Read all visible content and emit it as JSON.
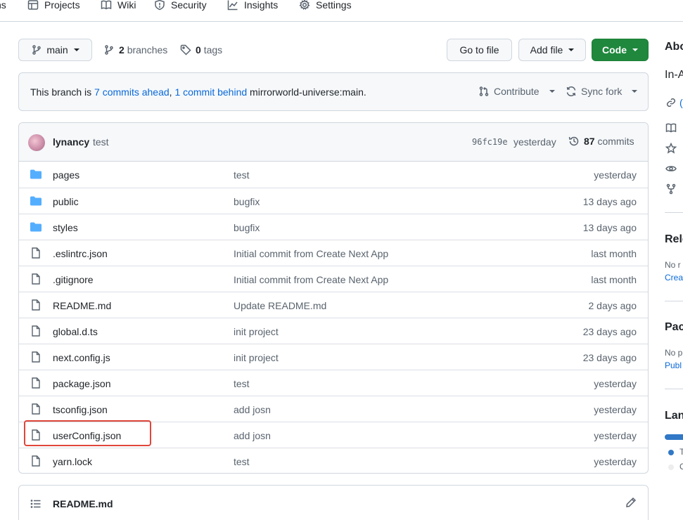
{
  "nav": {
    "items": [
      {
        "label": "ns",
        "icon": "play-icon"
      },
      {
        "label": "Projects",
        "icon": "table-icon"
      },
      {
        "label": "Wiki",
        "icon": "book-icon"
      },
      {
        "label": "Security",
        "icon": "shield-icon"
      },
      {
        "label": "Insights",
        "icon": "graph-icon"
      },
      {
        "label": "Settings",
        "icon": "gear-icon"
      }
    ]
  },
  "toolbar": {
    "branch": "main",
    "branches_count": "2",
    "branches_label": "branches",
    "tags_count": "0",
    "tags_label": "tags",
    "go_to_file": "Go to file",
    "add_file": "Add file",
    "code": "Code"
  },
  "branch_status": {
    "prefix": "This branch is",
    "ahead": "7 commits ahead",
    "separator": ",",
    "behind": "1 commit behind",
    "upstream": "mirrorworld-universe:main.",
    "contribute": "Contribute",
    "sync_fork": "Sync fork"
  },
  "latest_commit": {
    "author": "lynancy",
    "message": "test",
    "hash": "96fc19e",
    "date": "yesterday",
    "count": "87",
    "count_label": "commits"
  },
  "files": [
    {
      "name": "pages",
      "type": "dir",
      "message": "test",
      "date": "yesterday"
    },
    {
      "name": "public",
      "type": "dir",
      "message": "bugfix",
      "date": "13 days ago"
    },
    {
      "name": "styles",
      "type": "dir",
      "message": "bugfix",
      "date": "13 days ago"
    },
    {
      "name": ".eslintrc.json",
      "type": "file",
      "message": "Initial commit from Create Next App",
      "date": "last month"
    },
    {
      "name": ".gitignore",
      "type": "file",
      "message": "Initial commit from Create Next App",
      "date": "last month"
    },
    {
      "name": "README.md",
      "type": "file",
      "message": "Update README.md",
      "date": "2 days ago"
    },
    {
      "name": "global.d.ts",
      "type": "file",
      "message": "init project",
      "date": "23 days ago"
    },
    {
      "name": "next.config.js",
      "type": "file",
      "message": "init project",
      "date": "23 days ago"
    },
    {
      "name": "package.json",
      "type": "file",
      "message": "test",
      "date": "yesterday"
    },
    {
      "name": "tsconfig.json",
      "type": "file",
      "message": "add josn",
      "date": "yesterday"
    },
    {
      "name": "userConfig.json",
      "type": "file",
      "message": "add josn",
      "date": "yesterday"
    },
    {
      "name": "yarn.lock",
      "type": "file",
      "message": "test",
      "date": "yesterday"
    }
  ],
  "readme": {
    "title": "README.md"
  },
  "sidebar": {
    "about_heading": "Abo",
    "about_text": "In-A",
    "link_text": "(",
    "releases_heading": "Rele",
    "releases_text": "No r",
    "releases_link": "Crea",
    "packages_heading": "Pac",
    "packages_text": "No p",
    "packages_link": "Publ",
    "languages_heading": "Lan",
    "lang_1_label": "T",
    "lang_2_label": "C"
  },
  "colors": {
    "accent_link": "#0969da",
    "code_button": "#1f883d",
    "highlight_box": "#e0463a",
    "folder": "#54aeff"
  }
}
